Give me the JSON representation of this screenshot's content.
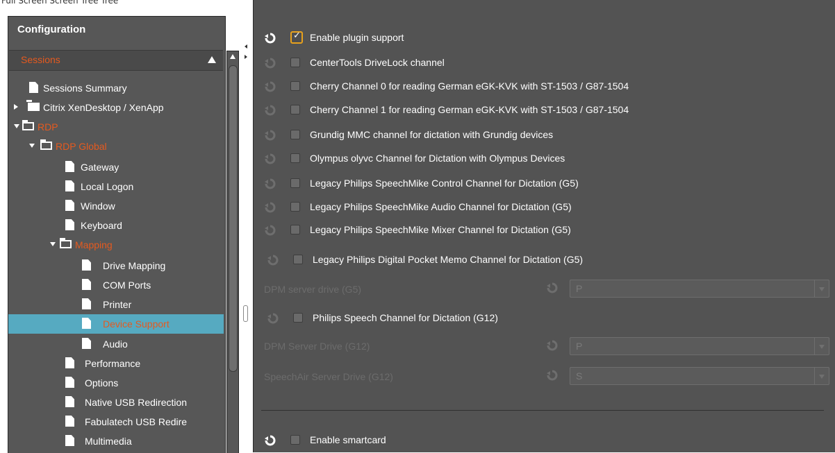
{
  "topstrip": {
    "text": "Full Screen Screen Tree Tree"
  },
  "config": {
    "title": "Configuration"
  },
  "sessions": {
    "label": "Sessions"
  },
  "tree": [
    {
      "label": "Sessions Summary"
    },
    {
      "label": "Citrix XenDesktop / XenApp"
    },
    {
      "label": "RDP"
    },
    {
      "label": "RDP Global"
    },
    {
      "label": "Gateway"
    },
    {
      "label": "Local Logon"
    },
    {
      "label": "Window"
    },
    {
      "label": "Keyboard"
    },
    {
      "label": "Mapping"
    },
    {
      "label": "Drive Mapping"
    },
    {
      "label": "COM Ports"
    },
    {
      "label": "Printer"
    },
    {
      "label": "Device Support"
    },
    {
      "label": "Audio"
    },
    {
      "label": "Performance"
    },
    {
      "label": "Options"
    },
    {
      "label": "Native USB Redirection"
    },
    {
      "label": "Fabulatech USB Redire"
    },
    {
      "label": "Multimedia"
    }
  ],
  "options": [
    {
      "label": "Enable plugin support",
      "checked": true
    },
    {
      "label": "CenterTools DriveLock channel",
      "checked": false
    },
    {
      "label": "Cherry Channel 0 for reading German eGK-KVK with ST-1503 / G87-1504",
      "checked": false
    },
    {
      "label": "Cherry Channel 1 for reading German eGK-KVK with ST-1503 / G87-1504",
      "checked": false
    },
    {
      "label": "Grundig MMC channel for dictation with Grundig devices",
      "checked": false
    },
    {
      "label": "Olympus olyvc Channel for Dictation with Olympus Devices",
      "checked": false
    },
    {
      "label": "Legacy Philips SpeechMike Control Channel for Dictation (G5)",
      "checked": false
    },
    {
      "label": "Legacy Philips SpeechMike Audio Channel for Dictation (G5)",
      "checked": false
    },
    {
      "label": "Legacy Philips SpeechMike Mixer Channel for Dictation (G5)",
      "checked": false
    },
    {
      "label": "Legacy Philips Digital Pocket Memo Channel for Dictation (G5)",
      "checked": false
    },
    {
      "label": "Philips Speech Channel for Dictation (G12)",
      "checked": false
    },
    {
      "label": "Enable smartcard",
      "checked": false
    }
  ],
  "fields": [
    {
      "label": "DPM server drive (G5)",
      "value": "P"
    },
    {
      "label": "DPM Server Drive (G12)",
      "value": "P"
    },
    {
      "label": "SpeechAir Server Drive (G12)",
      "value": "S"
    }
  ],
  "colors": {
    "accent": "#e55a1f",
    "selection": "#56aac1",
    "checkbox_border": "#e8a21d",
    "panel_bg": "#535353"
  },
  "icons": {
    "reset": "reset-icon",
    "document": "document-icon",
    "folder": "folder-icon"
  }
}
